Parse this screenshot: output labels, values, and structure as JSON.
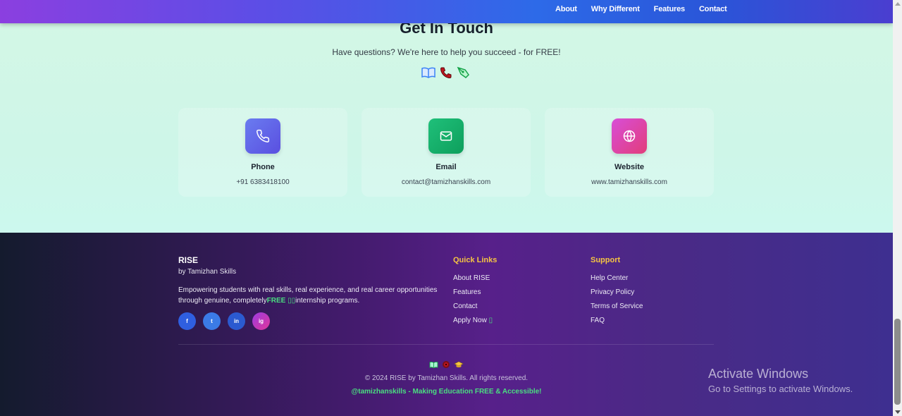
{
  "nav": {
    "links": [
      "About",
      "Why Different",
      "Features",
      "Contact"
    ]
  },
  "contact": {
    "title": "Get In Touch",
    "subtitle": "Have questions? We're here to help you succeed - for FREE!",
    "header_icons": [
      "open-book-icon",
      "telephone-receiver-icon",
      "pen-nib-icon"
    ],
    "cards": [
      {
        "label": "Phone",
        "value": "+91 6383418100",
        "icon": "phone-icon",
        "color_from": "#6a7cf0",
        "color_to": "#5a4fe0"
      },
      {
        "label": "Email",
        "value": "contact@tamizhanskills.com",
        "icon": "mail-icon",
        "color_from": "#1fc07a",
        "color_to": "#0e9f5c"
      },
      {
        "label": "Website",
        "value": "www.tamizhanskills.com",
        "icon": "globe-icon",
        "color_from": "#d84ed8",
        "color_to": "#e23d7a"
      }
    ]
  },
  "footer": {
    "brand": "RISE",
    "brand_sub": "by Tamizhan Skills",
    "description_pre": "Empowering students with real skills, real experience, and real career opportunities through genuine, completely",
    "description_free": "FREE",
    "description_post": "internship programs.",
    "socials": [
      {
        "label": "f",
        "icon": "facebook-icon",
        "color": "#2f5fe0"
      },
      {
        "label": "t",
        "icon": "twitter-icon",
        "color": "#3b7be6"
      },
      {
        "label": "in",
        "icon": "linkedin-icon",
        "color": "#2b5ad0"
      },
      {
        "label": "ig",
        "icon": "instagram-icon",
        "color": "#c33bc8"
      }
    ],
    "quick_links": {
      "heading": "Quick Links",
      "items": [
        "About RISE",
        "Features",
        "Contact",
        "Apply Now"
      ]
    },
    "support": {
      "heading": "Support",
      "items": [
        "Help Center",
        "Privacy Policy",
        "Terms of Service",
        "FAQ"
      ]
    },
    "bottom_icons": [
      "open-book-icon",
      "bullseye-icon",
      "graduation-cap-icon"
    ],
    "copyright": "© 2024 RISE by Tamizhan Skills. All rights reserved.",
    "tagline": "@tamizhanskills - Making Education FREE & Accessible!"
  },
  "windows_watermark": {
    "line1": "Activate Windows",
    "line2": "Go to Settings to activate Windows."
  },
  "colors": {
    "accent_green": "#4ade80",
    "heading_yellow": "#f6c542"
  }
}
